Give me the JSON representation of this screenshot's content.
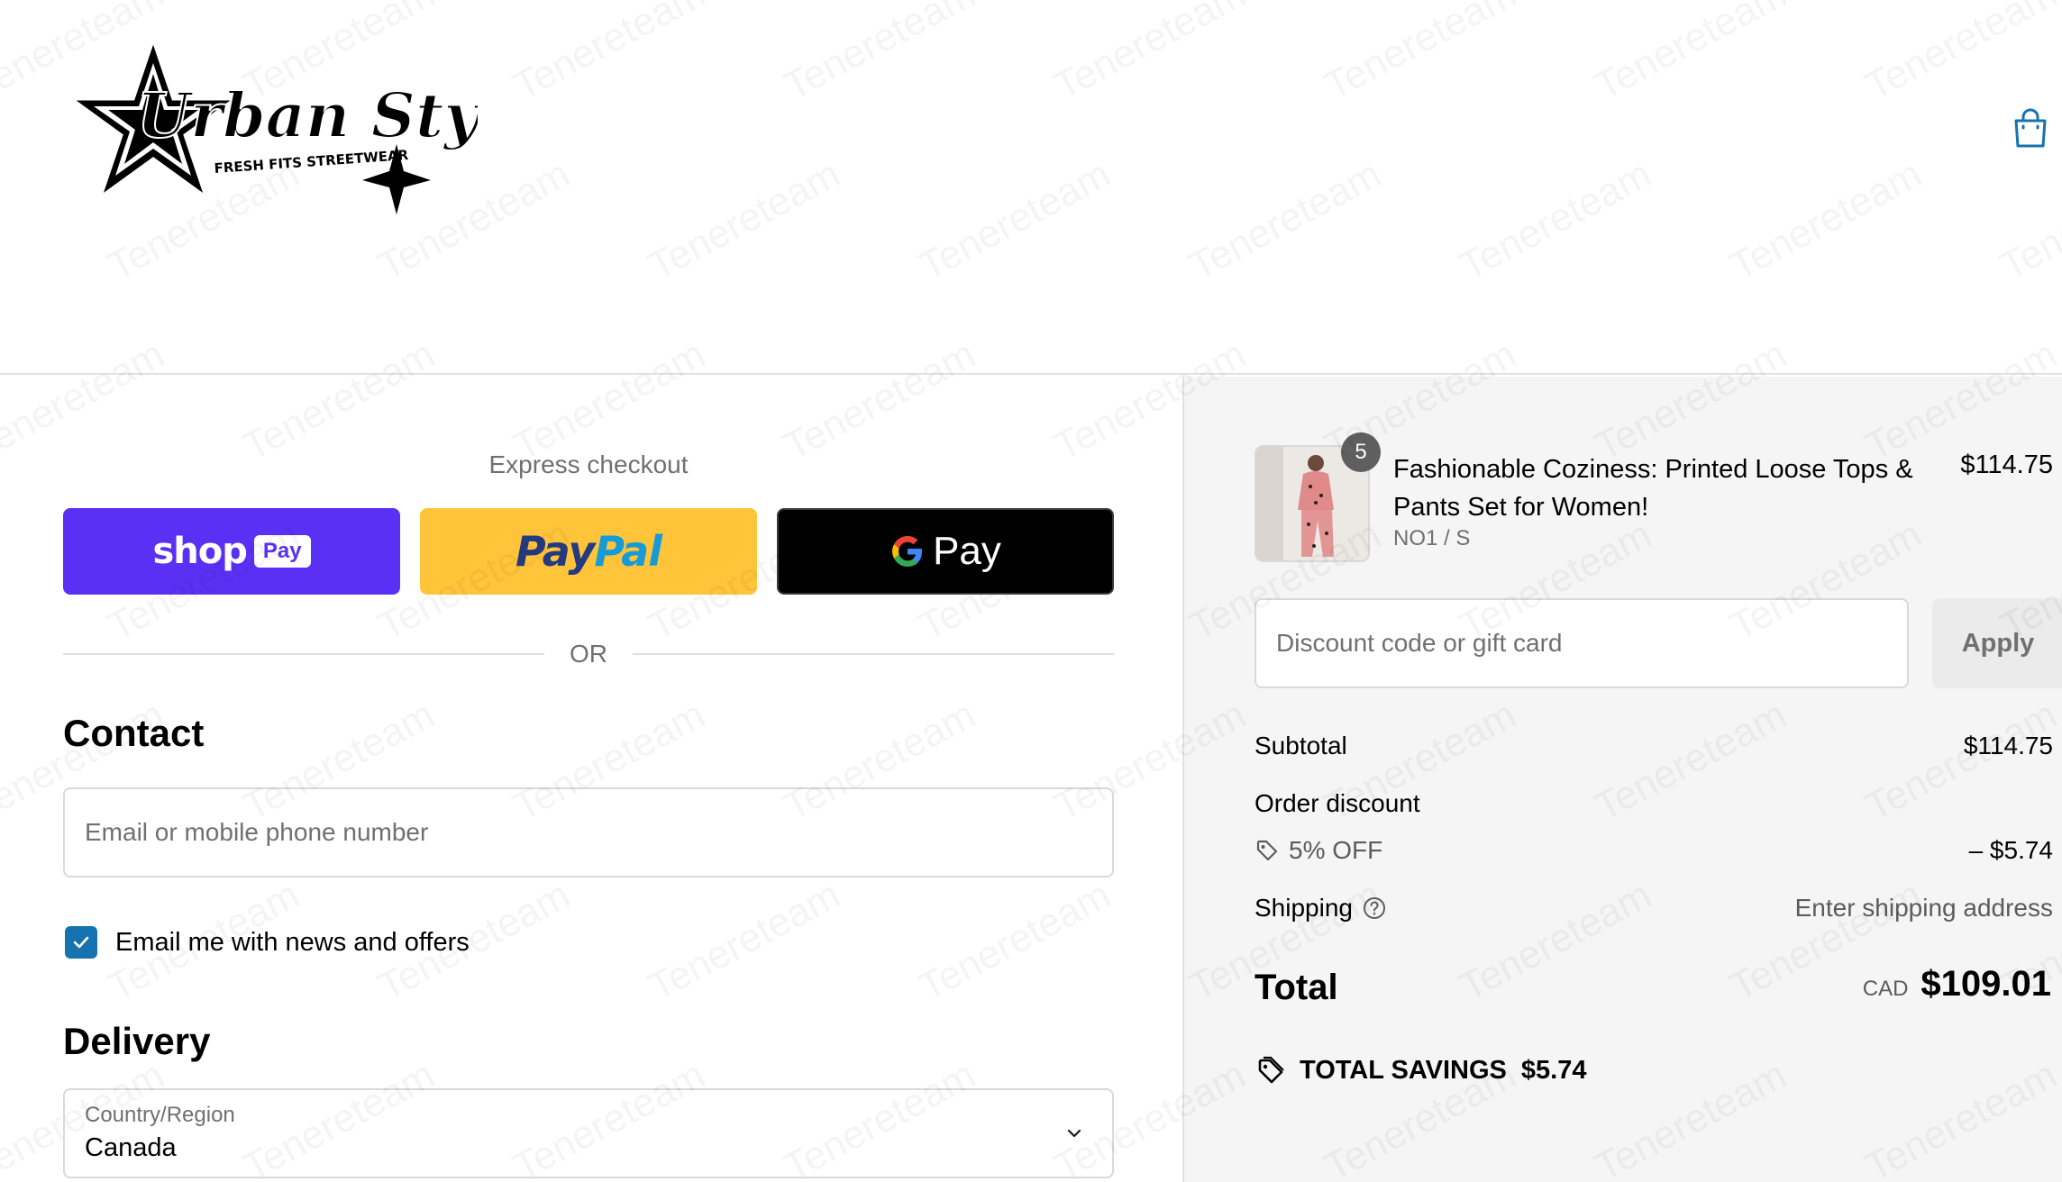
{
  "header": {
    "logo_main": "Urban Style",
    "logo_tag": "FRESH FITS STREETWEAR",
    "cart_icon": "shopping-bag-icon"
  },
  "express": {
    "label": "Express checkout",
    "shop_pay": {
      "text": "shop",
      "box": "Pay",
      "color": "#5a31f4"
    },
    "paypal": {
      "part_a": "Pay",
      "part_b": "Pal",
      "color": "#ffc439"
    },
    "google_pay": {
      "g": "G",
      "text": "Pay",
      "color": "#000000"
    },
    "divider": "OR"
  },
  "contact": {
    "title": "Contact",
    "email_placeholder": "Email or mobile phone number",
    "news_checkbox_checked": true,
    "news_label": "Email me with news and offers"
  },
  "delivery": {
    "title": "Delivery",
    "country_label": "Country/Region",
    "country_value": "Canada"
  },
  "order": {
    "quantity": "5",
    "product_name": "Fashionable Coziness: Printed Loose Tops & Pants Set for Women!",
    "variant": "NO1 / S",
    "price": "$114.75",
    "discount_placeholder": "Discount code or gift card",
    "apply_label": "Apply",
    "subtotal_label": "Subtotal",
    "subtotal_value": "$114.75",
    "order_discount_label": "Order discount",
    "discount_code": "5% OFF",
    "discount_value": "– $5.74",
    "shipping_label": "Shipping",
    "shipping_value": "Enter shipping address",
    "total_label": "Total",
    "currency": "CAD",
    "total_value": "$109.01",
    "savings_label": "TOTAL SAVINGS",
    "savings_value": "$5.74"
  },
  "watermark": "Tenereteam",
  "colors": {
    "accent": "#1773b0",
    "summary_bg": "#f5f5f5",
    "border": "#d9d9d9"
  }
}
